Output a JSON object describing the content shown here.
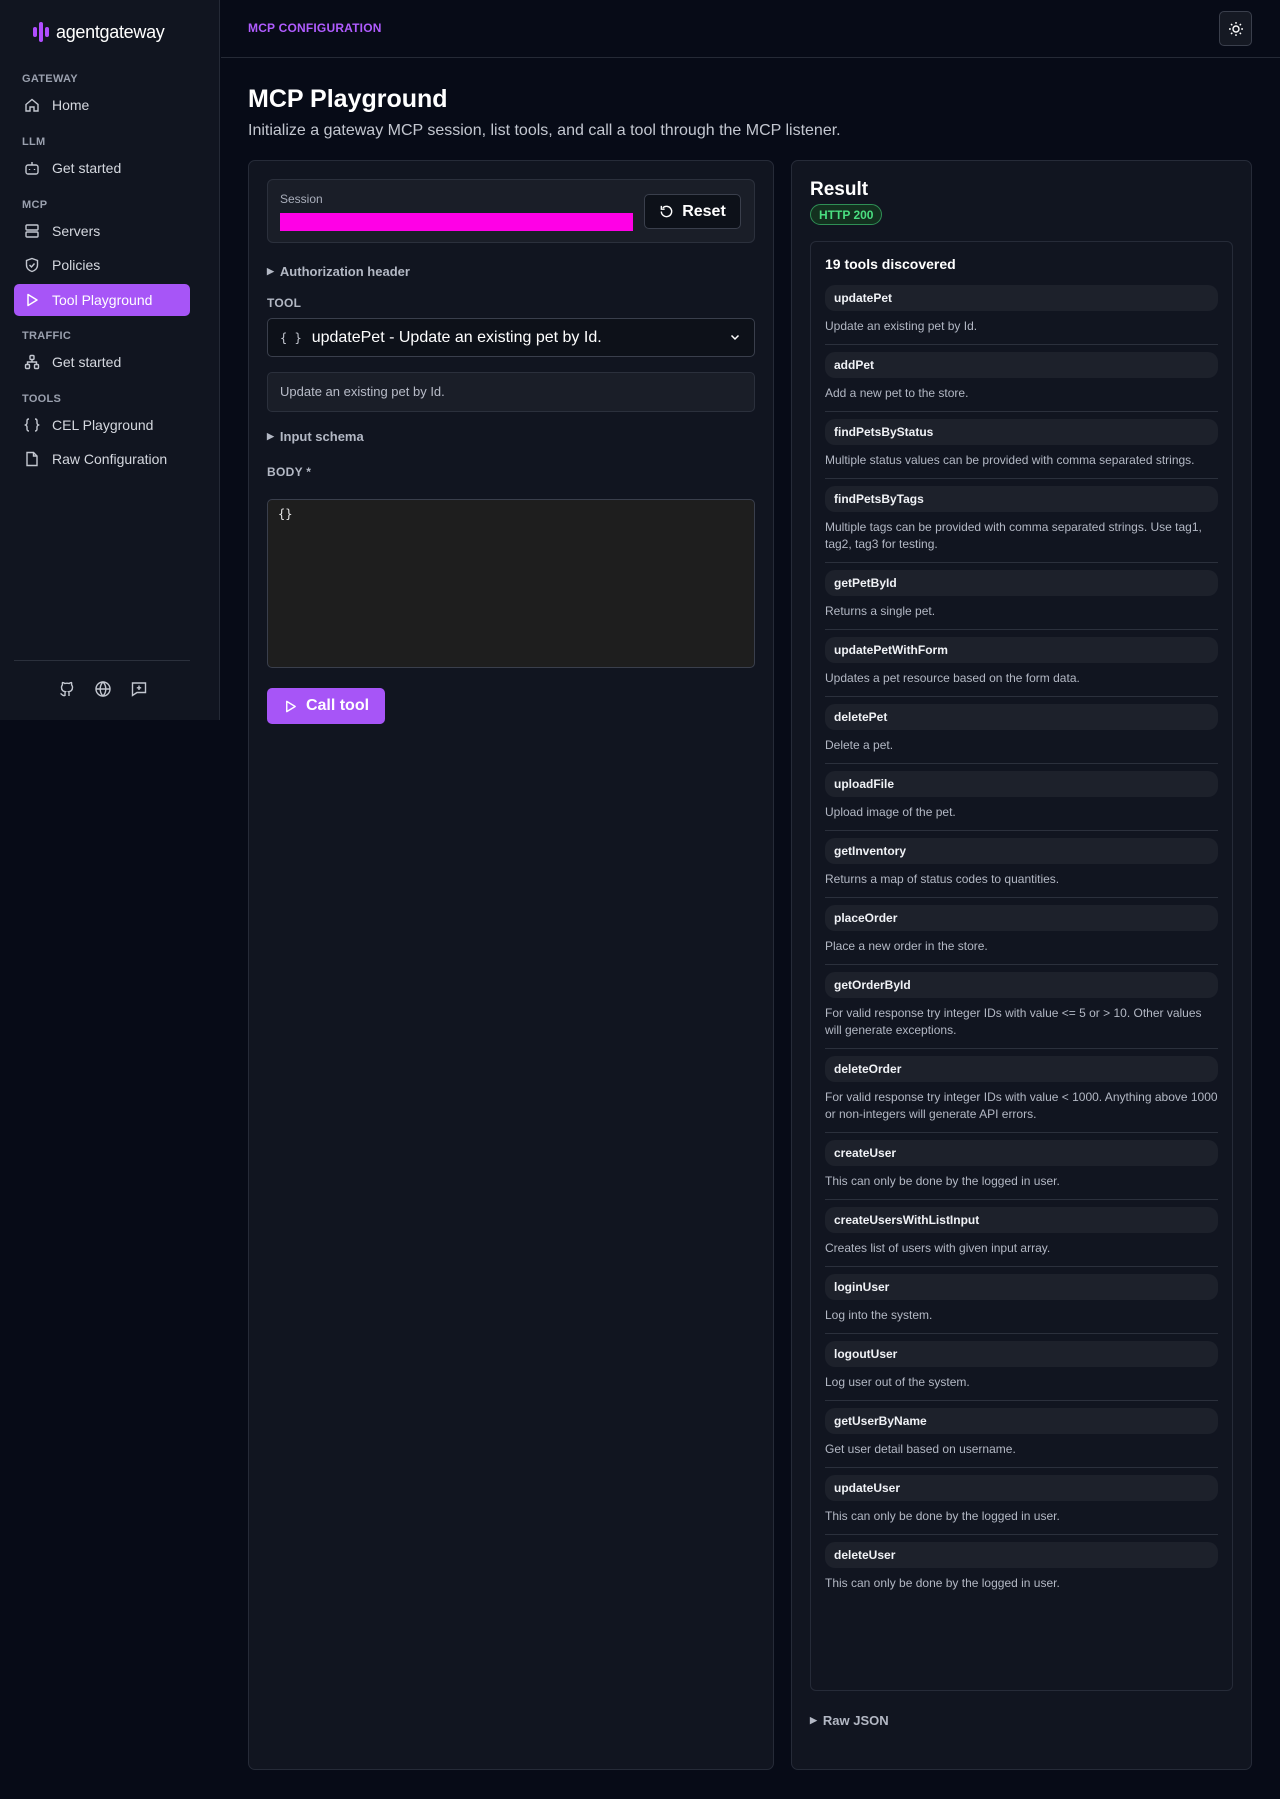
{
  "app": {
    "logo_text": "agentgateway",
    "brand_color": "#a755f7"
  },
  "sidebar": {
    "sections": [
      {
        "label": "GATEWAY",
        "items": [
          {
            "label": "Home",
            "icon": "home-icon"
          }
        ]
      },
      {
        "label": "LLM",
        "items": [
          {
            "label": "Get started",
            "icon": "bot-icon"
          }
        ]
      },
      {
        "label": "MCP",
        "items": [
          {
            "label": "Servers",
            "icon": "server-icon"
          },
          {
            "label": "Policies",
            "icon": "shield-icon"
          },
          {
            "label": "Tool Playground",
            "icon": "play-icon",
            "active": true
          }
        ]
      },
      {
        "label": "TRAFFIC",
        "items": [
          {
            "label": "Get started",
            "icon": "network-icon"
          }
        ]
      },
      {
        "label": "TOOLS",
        "items": [
          {
            "label": "CEL Playground",
            "icon": "braces-icon"
          },
          {
            "label": "Raw Configuration",
            "icon": "file-icon"
          }
        ]
      }
    ],
    "footer_icons": [
      "github-icon",
      "globe-icon",
      "feedback-icon"
    ]
  },
  "header": {
    "breadcrumb": "MCP CONFIGURATION",
    "theme_toggle_icon": "sun-icon"
  },
  "page": {
    "title": "MCP Playground",
    "subtitle": "Initialize a gateway MCP session, list tools, and call a tool through the MCP listener."
  },
  "left_panel": {
    "session_label": "Session",
    "session_value": "",
    "reset_label": "Reset",
    "auth_header_label": "Authorization header",
    "tool_label": "TOOL",
    "tool_selected": "updatePet - Update an existing pet by Id.",
    "tool_description": "Update an existing pet by Id.",
    "input_schema_label": "Input schema",
    "body_label": "BODY *",
    "body_value": "{}",
    "call_label": "Call tool"
  },
  "right_panel": {
    "title": "Result",
    "status": "HTTP 200",
    "tools_count": "19 tools discovered",
    "raw_json_label": "Raw JSON",
    "tools": [
      {
        "name": "updatePet",
        "desc": "Update an existing pet by Id."
      },
      {
        "name": "addPet",
        "desc": "Add a new pet to the store."
      },
      {
        "name": "findPetsByStatus",
        "desc": "Multiple status values can be provided with comma separated strings."
      },
      {
        "name": "findPetsByTags",
        "desc": "Multiple tags can be provided with comma separated strings. Use tag1, tag2, tag3 for testing."
      },
      {
        "name": "getPetById",
        "desc": "Returns a single pet."
      },
      {
        "name": "updatePetWithForm",
        "desc": "Updates a pet resource based on the form data."
      },
      {
        "name": "deletePet",
        "desc": "Delete a pet."
      },
      {
        "name": "uploadFile",
        "desc": "Upload image of the pet."
      },
      {
        "name": "getInventory",
        "desc": "Returns a map of status codes to quantities."
      },
      {
        "name": "placeOrder",
        "desc": "Place a new order in the store."
      },
      {
        "name": "getOrderById",
        "desc": "For valid response try integer IDs with value <= 5 or > 10. Other values will generate exceptions."
      },
      {
        "name": "deleteOrder",
        "desc": "For valid response try integer IDs with value < 1000. Anything above 1000 or non-integers will generate API errors."
      },
      {
        "name": "createUser",
        "desc": "This can only be done by the logged in user."
      },
      {
        "name": "createUsersWithListInput",
        "desc": "Creates list of users with given input array."
      },
      {
        "name": "loginUser",
        "desc": "Log into the system."
      },
      {
        "name": "logoutUser",
        "desc": "Log user out of the system."
      },
      {
        "name": "getUserByName",
        "desc": "Get user detail based on username."
      },
      {
        "name": "updateUser",
        "desc": "This can only be done by the logged in user."
      },
      {
        "name": "deleteUser",
        "desc": "This can only be done by the logged in user."
      }
    ]
  }
}
